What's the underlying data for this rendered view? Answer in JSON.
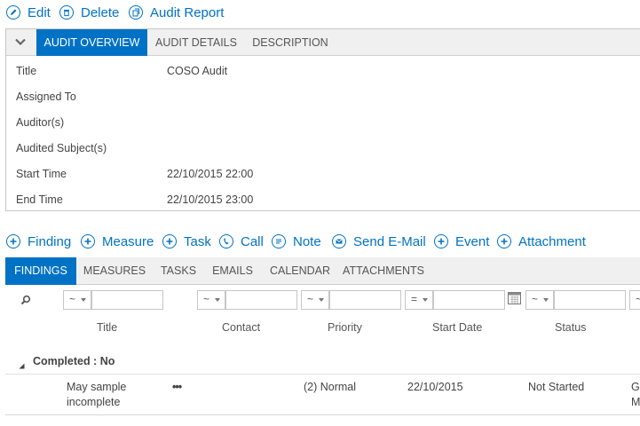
{
  "toolbar": {
    "edit": "Edit",
    "delete": "Delete",
    "audit_report": "Audit Report"
  },
  "top_tabs": [
    "AUDIT OVERVIEW",
    "AUDIT DETAILS",
    "DESCRIPTION"
  ],
  "overview": {
    "fields": [
      {
        "label": "Title",
        "value": "COSO Audit"
      },
      {
        "label": "Assigned To",
        "value": ""
      },
      {
        "label": "Auditor(s)",
        "value": ""
      },
      {
        "label": "Audited Subject(s)",
        "value": ""
      },
      {
        "label": "Start Time",
        "value": "22/10/2015 22:00"
      },
      {
        "label": "End Time",
        "value": "22/10/2015 23:00"
      }
    ]
  },
  "actions": {
    "finding": "Finding",
    "measure": "Measure",
    "task": "Task",
    "call": "Call",
    "note": "Note",
    "send_email": "Send E-Mail",
    "event": "Event",
    "attachment": "Attachment"
  },
  "bottom_tabs": [
    "FINDINGS",
    "MEASURES",
    "TASKS",
    "EMAILS",
    "CALENDAR",
    "ATTACHMENTS"
  ],
  "filters": {
    "ops": [
      "~",
      "~",
      "~",
      "=",
      "~",
      "~"
    ]
  },
  "columns": [
    "Title",
    "Contact",
    "Priority",
    "Start Date",
    "Status"
  ],
  "group": {
    "label": "Completed : No"
  },
  "row": {
    "title_line1": "May sample",
    "title_line2": "incomplete",
    "menu": "•••",
    "priority": "(2) Normal",
    "start_date": "22/10/2015",
    "status": "Not Started",
    "extra1": "G",
    "extra2": "M"
  },
  "colors": {
    "accent": "#0072c6",
    "tabbar": "#f0f0f0",
    "border": "#c6c6c6"
  }
}
